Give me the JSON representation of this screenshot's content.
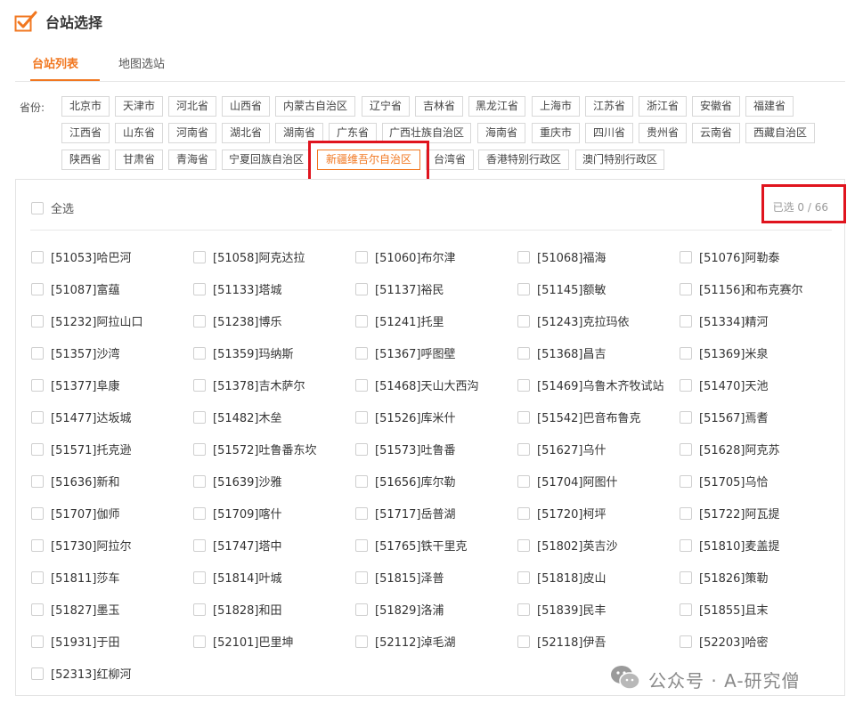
{
  "header": {
    "title": "台站选择",
    "icon": "checkbox-check-icon",
    "accent": "#f17720"
  },
  "tabs": [
    {
      "label": "台站列表",
      "active": true
    },
    {
      "label": "地图选站",
      "active": false
    }
  ],
  "province_filter": {
    "label": "省份:",
    "selected": "新疆维吾尔自治区",
    "rows": [
      [
        "北京市",
        "天津市",
        "河北省",
        "山西省",
        "内蒙古自治区",
        "辽宁省",
        "吉林省",
        "黑龙江省",
        "上海市",
        "江苏省",
        "浙江省",
        "安徽省",
        "福建省"
      ],
      [
        "江西省",
        "山东省",
        "河南省",
        "湖北省",
        "湖南省",
        "广东省",
        "广西壮族自治区",
        "海南省",
        "重庆市",
        "四川省",
        "贵州省",
        "云南省",
        "西藏自治区"
      ],
      [
        "陕西省",
        "甘肃省",
        "青海省",
        "宁夏回族自治区",
        "新疆维吾尔自治区",
        "台湾省",
        "香港特别行政区",
        "澳门特别行政区"
      ]
    ]
  },
  "station_panel": {
    "select_all_label": "全选",
    "count_text": "已选 0 / 66",
    "stations": [
      "[51053]哈巴河",
      "[51058]阿克达拉",
      "[51060]布尔津",
      "[51068]福海",
      "[51076]阿勒泰",
      "[51087]富蕴",
      "[51133]塔城",
      "[51137]裕民",
      "[51145]额敏",
      "[51156]和布克赛尔",
      "[51232]阿拉山口",
      "[51238]博乐",
      "[51241]托里",
      "[51243]克拉玛依",
      "[51334]精河",
      "[51357]沙湾",
      "[51359]玛纳斯",
      "[51367]呼图壁",
      "[51368]昌吉",
      "[51369]米泉",
      "[51377]阜康",
      "[51378]吉木萨尔",
      "[51468]天山大西沟",
      "[51469]乌鲁木齐牧试站",
      "[51470]天池",
      "[51477]达坂城",
      "[51482]木垒",
      "[51526]库米什",
      "[51542]巴音布鲁克",
      "[51567]焉耆",
      "[51571]托克逊",
      "[51572]吐鲁番东坎",
      "[51573]吐鲁番",
      "[51627]乌什",
      "[51628]阿克苏",
      "[51636]新和",
      "[51639]沙雅",
      "[51656]库尔勒",
      "[51704]阿图什",
      "[51705]乌恰",
      "[51707]伽师",
      "[51709]喀什",
      "[51717]岳普湖",
      "[51720]柯坪",
      "[51722]阿瓦提",
      "[51730]阿拉尔",
      "[51747]塔中",
      "[51765]铁干里克",
      "[51802]英吉沙",
      "[51810]麦盖提",
      "[51811]莎车",
      "[51814]叶城",
      "[51815]泽普",
      "[51818]皮山",
      "[51826]策勒",
      "[51827]墨玉",
      "[51828]和田",
      "[51829]洛浦",
      "[51839]民丰",
      "[51855]且末",
      "[51931]于田",
      "[52101]巴里坤",
      "[52112]淖毛湖",
      "[52118]伊吾",
      "[52203]哈密",
      "[52313]红柳河"
    ]
  },
  "watermark": {
    "text": "公众号 · A-研究僧",
    "icon": "wechat-icon"
  }
}
